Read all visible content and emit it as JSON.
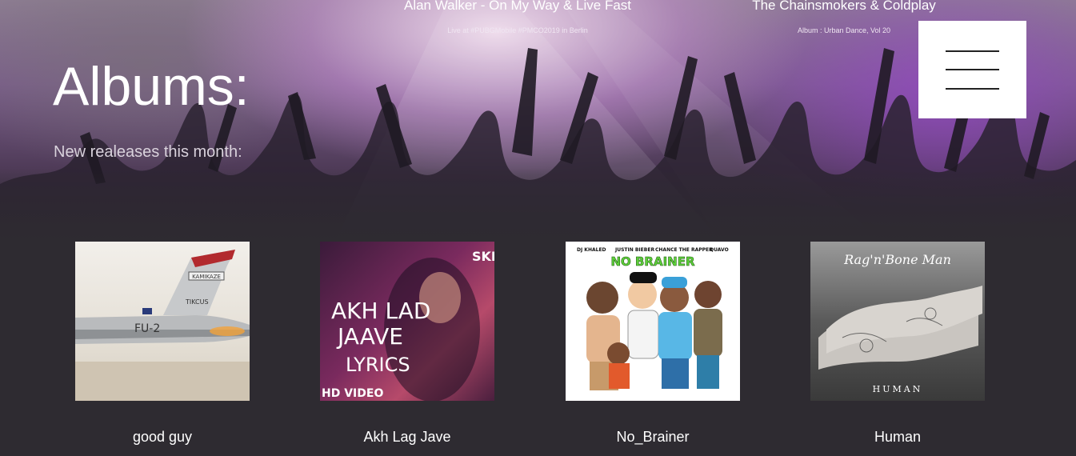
{
  "header": {
    "tracks": [
      {
        "title": "Alan Walker - On My Way & Live Fast",
        "subtitle": "Live at #PUBGMobile #PMCO2019 in Berlin"
      },
      {
        "title": "The Chainsmokers & Coldplay",
        "subtitle": "Album : Urban Dance, Vol 20"
      }
    ],
    "menu_icon": "hamburger-menu-icon"
  },
  "main": {
    "title": "Albums:",
    "subtitle": "New realeases this month:",
    "albums": [
      {
        "name": "good guy",
        "cover_text": [
          "KAMIKAZE",
          "TIKCUS",
          "FU-2"
        ]
      },
      {
        "name": "Akh Lag Jave",
        "cover_text": [
          "AKH LAD",
          "JAAVE",
          "LYRICS",
          "HD VIDEO",
          "SKF"
        ]
      },
      {
        "name": "No_Brainer",
        "cover_text": [
          "DJ KHALED",
          "JUSTIN BIEBER",
          "CHANCE THE RAPPER",
          "QUAVO",
          "NO BRAINER"
        ]
      },
      {
        "name": "Human",
        "cover_text": [
          "Rag'n'Bone Man",
          "HUMAN"
        ]
      }
    ]
  },
  "colors": {
    "background": "#2e2b31",
    "text": "#ffffff",
    "subtitle": "#d9d2dc",
    "menu_button": "#ffffff",
    "accent_purple": "#8a4ab0"
  }
}
